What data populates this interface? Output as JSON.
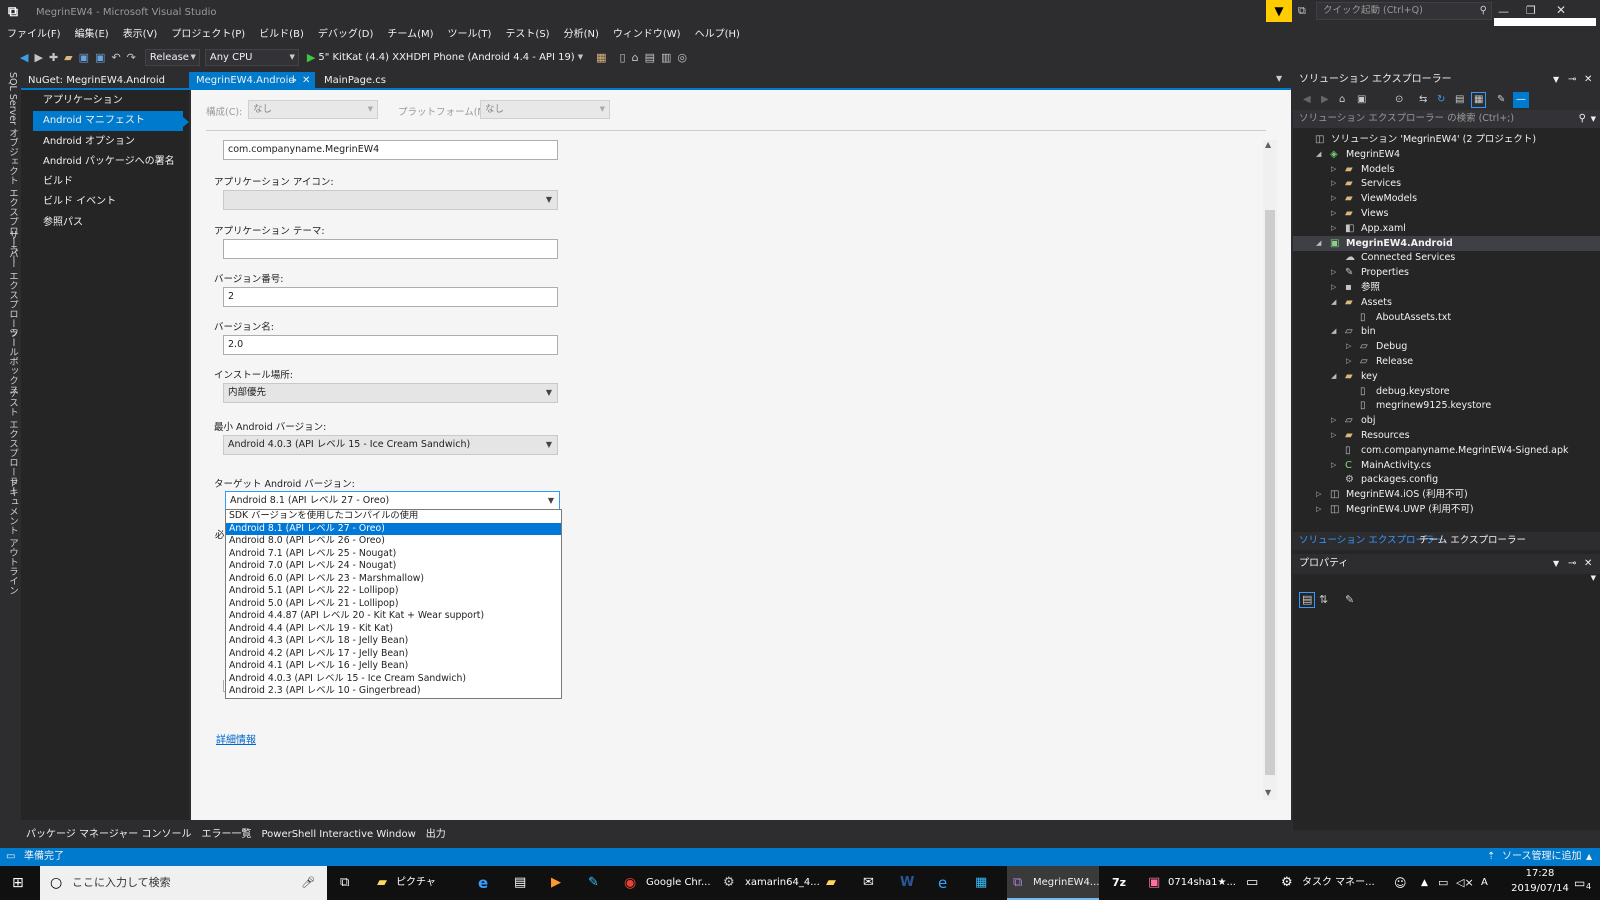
{
  "window": {
    "title": "MegrinEW4 - Microsoft Visual Studio",
    "quick_launch_placeholder": "クイック起動 (Ctrl+Q)"
  },
  "menu": [
    "ファイル(F)",
    "編集(E)",
    "表示(V)",
    "プロジェクト(P)",
    "ビルド(B)",
    "デバッグ(D)",
    "チーム(M)",
    "ツール(T)",
    "テスト(S)",
    "分析(N)",
    "ウィンドウ(W)",
    "ヘルプ(H)"
  ],
  "toolbar": {
    "config": "Release",
    "platform": "Any CPU",
    "run_target": "5\" KitKat (4.4) XXHDPI Phone (Android 4.4 - API 19)"
  },
  "left_strip": [
    "SQL Server オブジェクト エクスプローラー",
    "サーバー エクスプローラー",
    "ツールボックス",
    "テスト エクスプローラー",
    "ドキュメント アウトライン"
  ],
  "doc_tabs": [
    "NuGet: MegrinEW4.Android",
    "MegrinEW4.Android",
    "MainPage.cs"
  ],
  "nav": {
    "items": [
      "アプリケーション",
      "Android マニフェスト",
      "Android オプション",
      "Android パッケージへの署名",
      "ビルド",
      "ビルド イベント",
      "参照パス"
    ],
    "selected": 1
  },
  "config_row": {
    "config_label": "構成(C):",
    "config_value": "なし",
    "platform_label": "プラットフォーム(M):",
    "platform_value": "なし"
  },
  "form": {
    "package_name": "com.companyname.MegrinEW4",
    "app_icon_label": "アプリケーション アイコン:",
    "app_icon_value": "",
    "app_theme_label": "アプリケーション テーマ:",
    "app_theme_value": "",
    "version_code_label": "バージョン番号:",
    "version_code_value": "2",
    "version_name_label": "バージョン名:",
    "version_name_value": "2.0",
    "install_location_label": "インストール場所:",
    "install_location_value": "内部優先",
    "min_sdk_label": "最小 Android バージョン:",
    "min_sdk_value": "Android 4.0.3 (API レベル 15 - Ice Cream Sandwich)",
    "target_sdk_label": "ターゲット Android バージョン:",
    "target_sdk_value": "Android 8.1 (API レベル 27 - Oreo)",
    "hidden_label_fragment": "必",
    "more_info_link": "詳細情報"
  },
  "target_sdk_options": [
    "SDK バージョンを使用したコンパイルの使用",
    "Android 8.1 (API レベル 27 - Oreo)",
    "Android 8.0 (API レベル 26 - Oreo)",
    "Android 7.1 (API レベル 25 - Nougat)",
    "Android 7.0 (API レベル 24 - Nougat)",
    "Android 6.0 (API レベル 23 - Marshmallow)",
    "Android 5.1 (API レベル 22 - Lollipop)",
    "Android 5.0 (API レベル 21 - Lollipop)",
    "Android 4.4.87 (API レベル 20 - Kit Kat + Wear support)",
    "Android 4.4 (API レベル 19 - Kit Kat)",
    "Android 4.3 (API レベル 18 - Jelly Bean)",
    "Android 4.2 (API レベル 17 - Jelly Bean)",
    "Android 4.1 (API レベル 16 - Jelly Bean)",
    "Android 4.0.3 (API レベル 15 - Ice Cream Sandwich)",
    "Android 2.3 (API レベル 10 - Gingerbread)"
  ],
  "target_sdk_highlighted": 1,
  "solution_explorer": {
    "title": "ソリューション エクスプローラー",
    "search_placeholder": "ソリューション エクスプローラー の検索 (Ctrl+;)",
    "nodes": [
      {
        "label": "ソリューション 'MegrinEW4' (2 プロジェクト)",
        "depth": 0,
        "exp": "",
        "icon": "solution-icon"
      },
      {
        "label": "MegrinEW4",
        "depth": 1,
        "exp": "open",
        "icon": "project-icon"
      },
      {
        "label": "Models",
        "depth": 2,
        "exp": "closed",
        "icon": "folder-icon"
      },
      {
        "label": "Services",
        "depth": 2,
        "exp": "closed",
        "icon": "folder-icon"
      },
      {
        "label": "ViewModels",
        "depth": 2,
        "exp": "closed",
        "icon": "folder-icon"
      },
      {
        "label": "Views",
        "depth": 2,
        "exp": "closed",
        "icon": "folder-icon"
      },
      {
        "label": "App.xaml",
        "depth": 2,
        "exp": "closed",
        "icon": "xaml-icon"
      },
      {
        "label": "MegrinEW4.Android",
        "depth": 1,
        "exp": "open",
        "icon": "android-project-icon",
        "sel": true
      },
      {
        "label": "Connected Services",
        "depth": 2,
        "exp": "",
        "icon": "connected-icon"
      },
      {
        "label": "Properties",
        "depth": 2,
        "exp": "closed",
        "icon": "wrench-icon"
      },
      {
        "label": "参照",
        "depth": 2,
        "exp": "closed",
        "icon": "references-icon"
      },
      {
        "label": "Assets",
        "depth": 2,
        "exp": "open",
        "icon": "folder-icon"
      },
      {
        "label": "AboutAssets.txt",
        "depth": 3,
        "exp": "",
        "icon": "file-icon"
      },
      {
        "label": "bin",
        "depth": 2,
        "exp": "open",
        "icon": "folder-outline-icon"
      },
      {
        "label": "Debug",
        "depth": 3,
        "exp": "closed",
        "icon": "folder-outline-icon"
      },
      {
        "label": "Release",
        "depth": 3,
        "exp": "closed",
        "icon": "folder-outline-icon"
      },
      {
        "label": "key",
        "depth": 2,
        "exp": "open",
        "icon": "folder-icon"
      },
      {
        "label": "debug.keystore",
        "depth": 3,
        "exp": "",
        "icon": "file-icon"
      },
      {
        "label": "megrinew9125.keystore",
        "depth": 3,
        "exp": "",
        "icon": "file-icon"
      },
      {
        "label": "obj",
        "depth": 2,
        "exp": "closed",
        "icon": "folder-outline-icon"
      },
      {
        "label": "Resources",
        "depth": 2,
        "exp": "closed",
        "icon": "folder-icon"
      },
      {
        "label": "com.companyname.MegrinEW4-Signed.apk",
        "depth": 2,
        "exp": "",
        "icon": "file-icon"
      },
      {
        "label": "MainActivity.cs",
        "depth": 2,
        "exp": "closed",
        "icon": "csharp-icon"
      },
      {
        "label": "packages.config",
        "depth": 2,
        "exp": "",
        "icon": "config-icon"
      },
      {
        "label": "MegrinEW4.iOS (利用不可)",
        "depth": 1,
        "exp": "closed",
        "icon": "project-unavailable-icon"
      },
      {
        "label": "MegrinEW4.UWP (利用不可)",
        "depth": 1,
        "exp": "closed",
        "icon": "project-unavailable-icon"
      }
    ],
    "bottom_tabs": [
      "ソリューション エクスプローラー",
      "チーム エクスプローラー"
    ]
  },
  "properties": {
    "title": "プロパティ"
  },
  "bottom_tabs": [
    "パッケージ マネージャー コンソール",
    "エラー一覧",
    "PowerShell Interactive Window",
    "出力"
  ],
  "status": {
    "left": "準備完了",
    "right": "ソース管理に追加"
  },
  "taskbar": {
    "search": "ここに入力して検索",
    "apps": [
      "ピクチャ",
      "Google Chr...",
      "xamarin64_4...",
      "MegrinEW4...",
      "0714sha1★...",
      "タスク マネー..."
    ],
    "ime": "A",
    "time": "17:28",
    "date": "2019/07/14",
    "notif_count": "4"
  },
  "colors": {
    "accent": "#007acc",
    "vs_purple": "#68217a",
    "folder": "#dcb67a"
  }
}
